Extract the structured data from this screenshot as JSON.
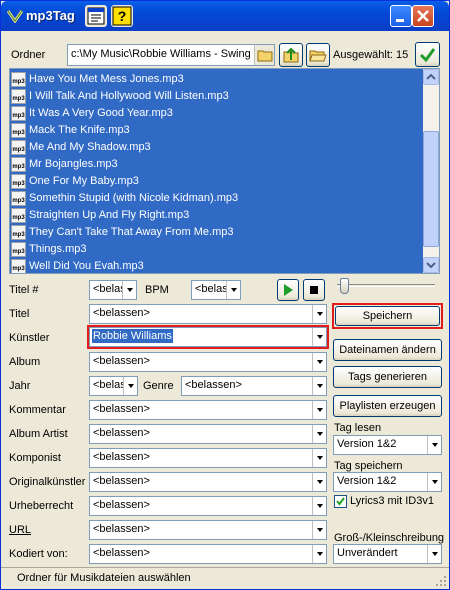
{
  "window": {
    "title": "mp3Tag"
  },
  "toolbar": {
    "folder_label": "Ordner",
    "folder_path": "c:\\My Music\\Robbie Williams - Swing When You're Winning",
    "selected_text": "Ausgewählt: 15"
  },
  "files": [
    "Have You Met Mess Jones.mp3",
    "I Will Talk And Hollywood Will Listen.mp3",
    "It Was A Very Good Year.mp3",
    "Mack The Knife.mp3",
    "Me And My Shadow.mp3",
    "Mr Bojangles.mp3",
    "One For My Baby.mp3",
    "Somethin Stupid (with Nicole Kidman).mp3",
    "Straighten Up And Fly Right.mp3",
    "They Can't Take That Away From Me.mp3",
    "Things.mp3",
    "Well Did You Evah.mp3"
  ],
  "file_icon_text": "mp3",
  "fields": {
    "track_label": "Titel #",
    "track_value": "<belassen>",
    "bpm_label": "BPM",
    "bpm_value": "<belassen>",
    "title_label": "Titel",
    "title_value": "<belassen>",
    "artist_label": "Künstler",
    "artist_value": "Robbie Williams",
    "album_label": "Album",
    "album_value": "<belassen>",
    "year_label": "Jahr",
    "year_value": "<belassen>",
    "genre_label": "Genre",
    "genre_value": "<belassen>",
    "comment_label": "Kommentar",
    "comment_value": "<belassen>",
    "album_artist_label": "Album Artist",
    "album_artist_value": "<belassen>",
    "composer_label": "Komponist",
    "composer_value": "<belassen>",
    "orig_artist_label": "Originalkünstler",
    "orig_artist_value": "<belassen>",
    "copyright_label": "Urheberrecht",
    "copyright_value": "<belassen>",
    "url_label": "URL",
    "url_value": "<belassen>",
    "encoded_label": "Kodiert von:",
    "encoded_value": "<belassen>"
  },
  "actions": {
    "save": "Speichern",
    "rename": "Dateinamen ändern",
    "generate_tags": "Tags generieren",
    "playlists": "Playlisten erzeugen",
    "read_tag_label": "Tag lesen",
    "read_tag_value": "Version 1&2",
    "save_tag_label": "Tag speichern",
    "save_tag_value": "Version 1&2",
    "lyrics_label": "Lyrics3 mit ID3v1",
    "lyrics_checked": true,
    "case_label": "Groß-/Kleinschreibung",
    "case_value": "Unverändert"
  },
  "status": {
    "text": "Ordner für Musikdateien auswählen"
  },
  "colors": {
    "selection": "#316ac5",
    "highlight_border": "#e21c1c",
    "play_green": "#1f9d2c"
  }
}
